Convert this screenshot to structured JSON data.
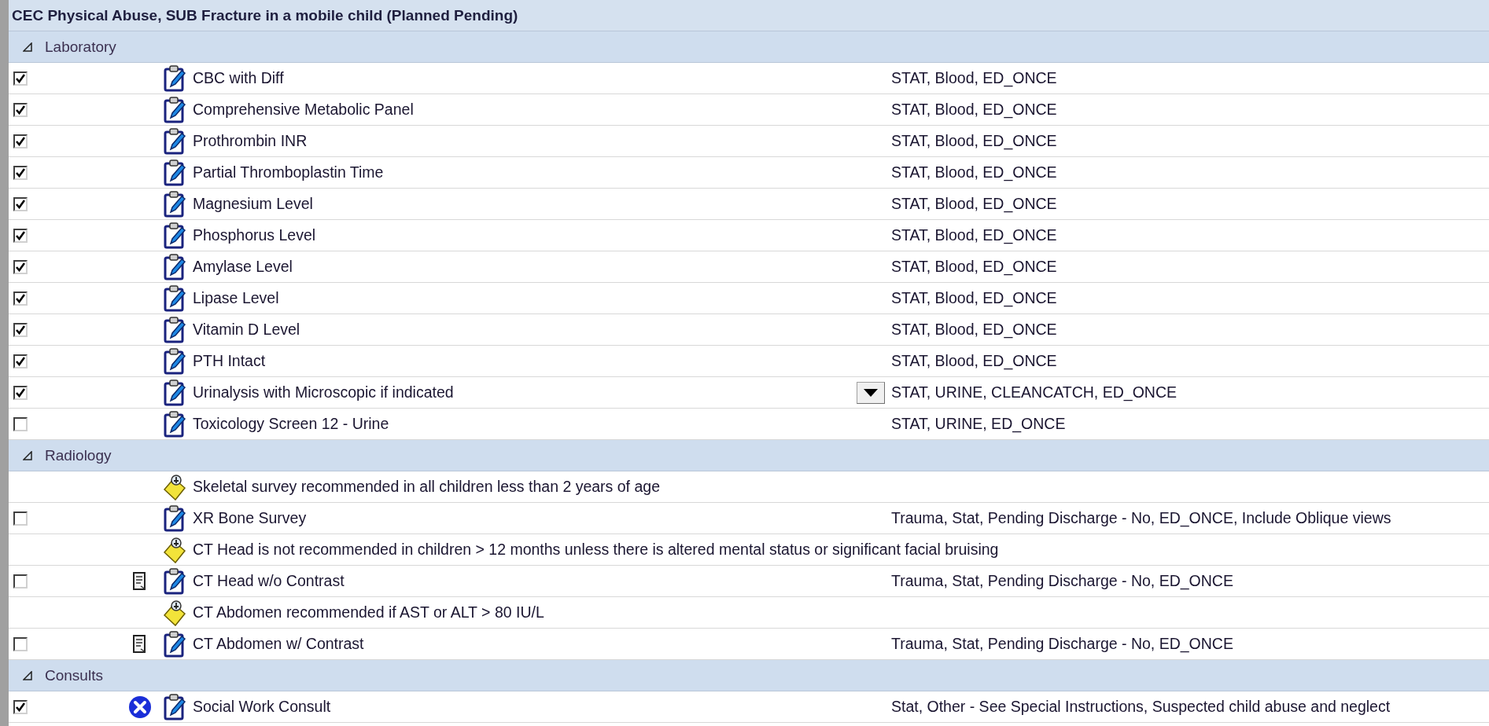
{
  "title": "CEC Physical Abuse, SUB Fracture in a mobile child (Planned Pending)",
  "sections": [
    {
      "label": "Laboratory",
      "expanded": true,
      "rows": [
        {
          "kind": "order",
          "checked": true,
          "name": "CBC with Diff",
          "details": "STAT, Blood, ED_ONCE"
        },
        {
          "kind": "order",
          "checked": true,
          "name": "Comprehensive Metabolic Panel",
          "details": "STAT, Blood, ED_ONCE"
        },
        {
          "kind": "order",
          "checked": true,
          "name": "Prothrombin INR",
          "details": "STAT, Blood, ED_ONCE"
        },
        {
          "kind": "order",
          "checked": true,
          "name": "Partial Thromboplastin Time",
          "details": "STAT, Blood, ED_ONCE"
        },
        {
          "kind": "order",
          "checked": true,
          "name": "Magnesium Level",
          "details": "STAT, Blood, ED_ONCE"
        },
        {
          "kind": "order",
          "checked": true,
          "name": "Phosphorus Level",
          "details": "STAT, Blood, ED_ONCE"
        },
        {
          "kind": "order",
          "checked": true,
          "name": "Amylase Level",
          "details": "STAT, Blood, ED_ONCE"
        },
        {
          "kind": "order",
          "checked": true,
          "name": "Lipase Level",
          "details": "STAT, Blood, ED_ONCE"
        },
        {
          "kind": "order",
          "checked": true,
          "name": "Vitamin D Level",
          "details": "STAT, Blood, ED_ONCE"
        },
        {
          "kind": "order",
          "checked": true,
          "name": "PTH Intact",
          "details": "STAT, Blood, ED_ONCE"
        },
        {
          "kind": "order",
          "checked": true,
          "name": "Urinalysis with Microscopic if indicated",
          "details": "STAT, URINE, CLEANCATCH, ED_ONCE",
          "editing": true
        },
        {
          "kind": "order",
          "checked": false,
          "name": "Toxicology Screen 12 - Urine",
          "details": "STAT, URINE, ED_ONCE"
        }
      ]
    },
    {
      "label": "Radiology",
      "expanded": true,
      "rows": [
        {
          "kind": "note",
          "text": "Skeletal survey recommended in all children less than 2 years of age"
        },
        {
          "kind": "order",
          "checked": false,
          "name": "XR Bone Survey",
          "details": "Trauma, Stat, Pending Discharge - No, ED_ONCE, Include Oblique views"
        },
        {
          "kind": "note",
          "text": "CT Head is not recommended in children > 12 months unless there is altered mental status or significant facial bruising"
        },
        {
          "kind": "order",
          "checked": false,
          "name": "CT Head w/o Contrast",
          "details": "Trauma, Stat, Pending Discharge - No, ED_ONCE",
          "has_document": true
        },
        {
          "kind": "note",
          "text": "CT Abdomen recommended if AST or ALT > 80 IU/L"
        },
        {
          "kind": "order",
          "checked": false,
          "name": "CT Abdomen w/ Contrast",
          "details": "Trauma, Stat, Pending Discharge - No, ED_ONCE",
          "has_document": true
        }
      ]
    },
    {
      "label": "Consults",
      "expanded": true,
      "rows": [
        {
          "kind": "order",
          "checked": true,
          "name": "Social Work Consult",
          "details": "Stat, Other - See Special Instructions, Suspected child abuse and neglect",
          "cancelled": true
        }
      ]
    }
  ]
}
